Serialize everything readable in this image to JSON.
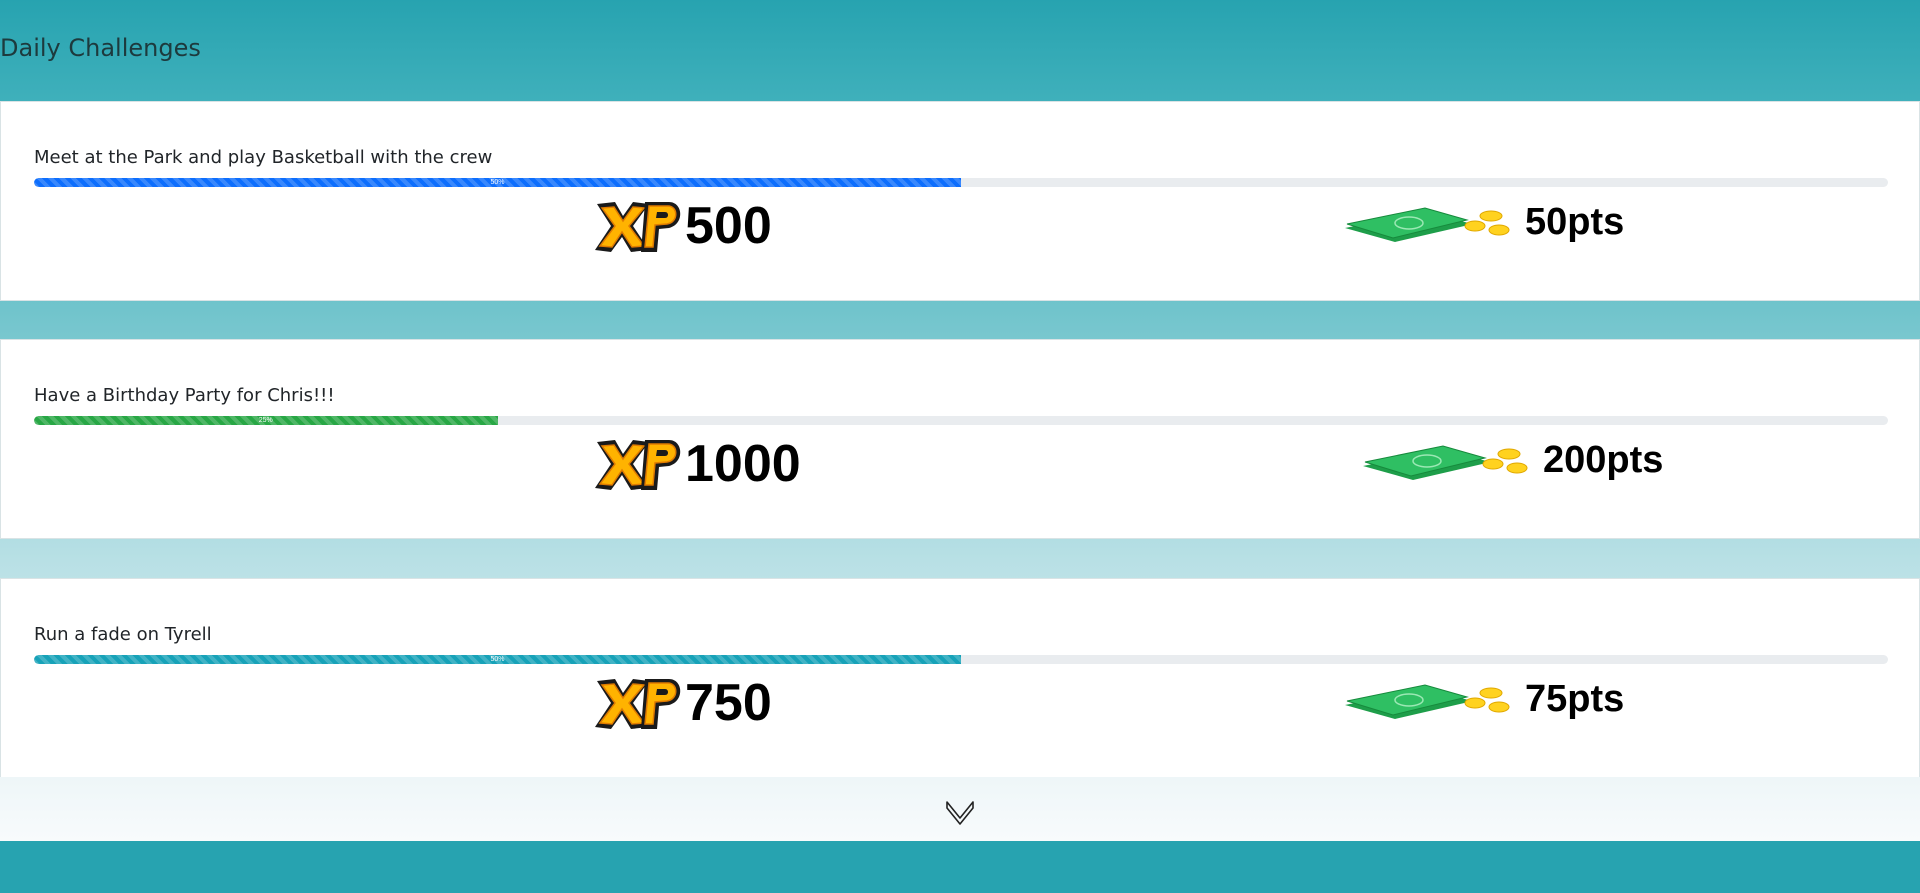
{
  "header": {
    "title": "Daily Challenges"
  },
  "challenges": [
    {
      "title": "Meet at the Park and play Basketball with the crew",
      "progress": 50,
      "progress_label": "50%",
      "xp": "500",
      "points": "50pts",
      "bar_color": "#0d6efd"
    },
    {
      "title": "Have a Birthday Party for Chris!!!",
      "progress": 25,
      "progress_label": "25%",
      "xp": "1000",
      "points": "200pts",
      "bar_color": "#28a745"
    },
    {
      "title": "Run a fade on Tyrell",
      "progress": 50,
      "progress_label": "50%",
      "xp": "750",
      "points": "75pts",
      "bar_color": "#17a2b8"
    }
  ],
  "icons": {
    "xp": "xp-badge-icon",
    "cash": "cash-coins-icon",
    "scroll": "chevron-down-icon"
  },
  "colors": {
    "header": "#27a3b0",
    "xp_gold": "#ffb300"
  }
}
